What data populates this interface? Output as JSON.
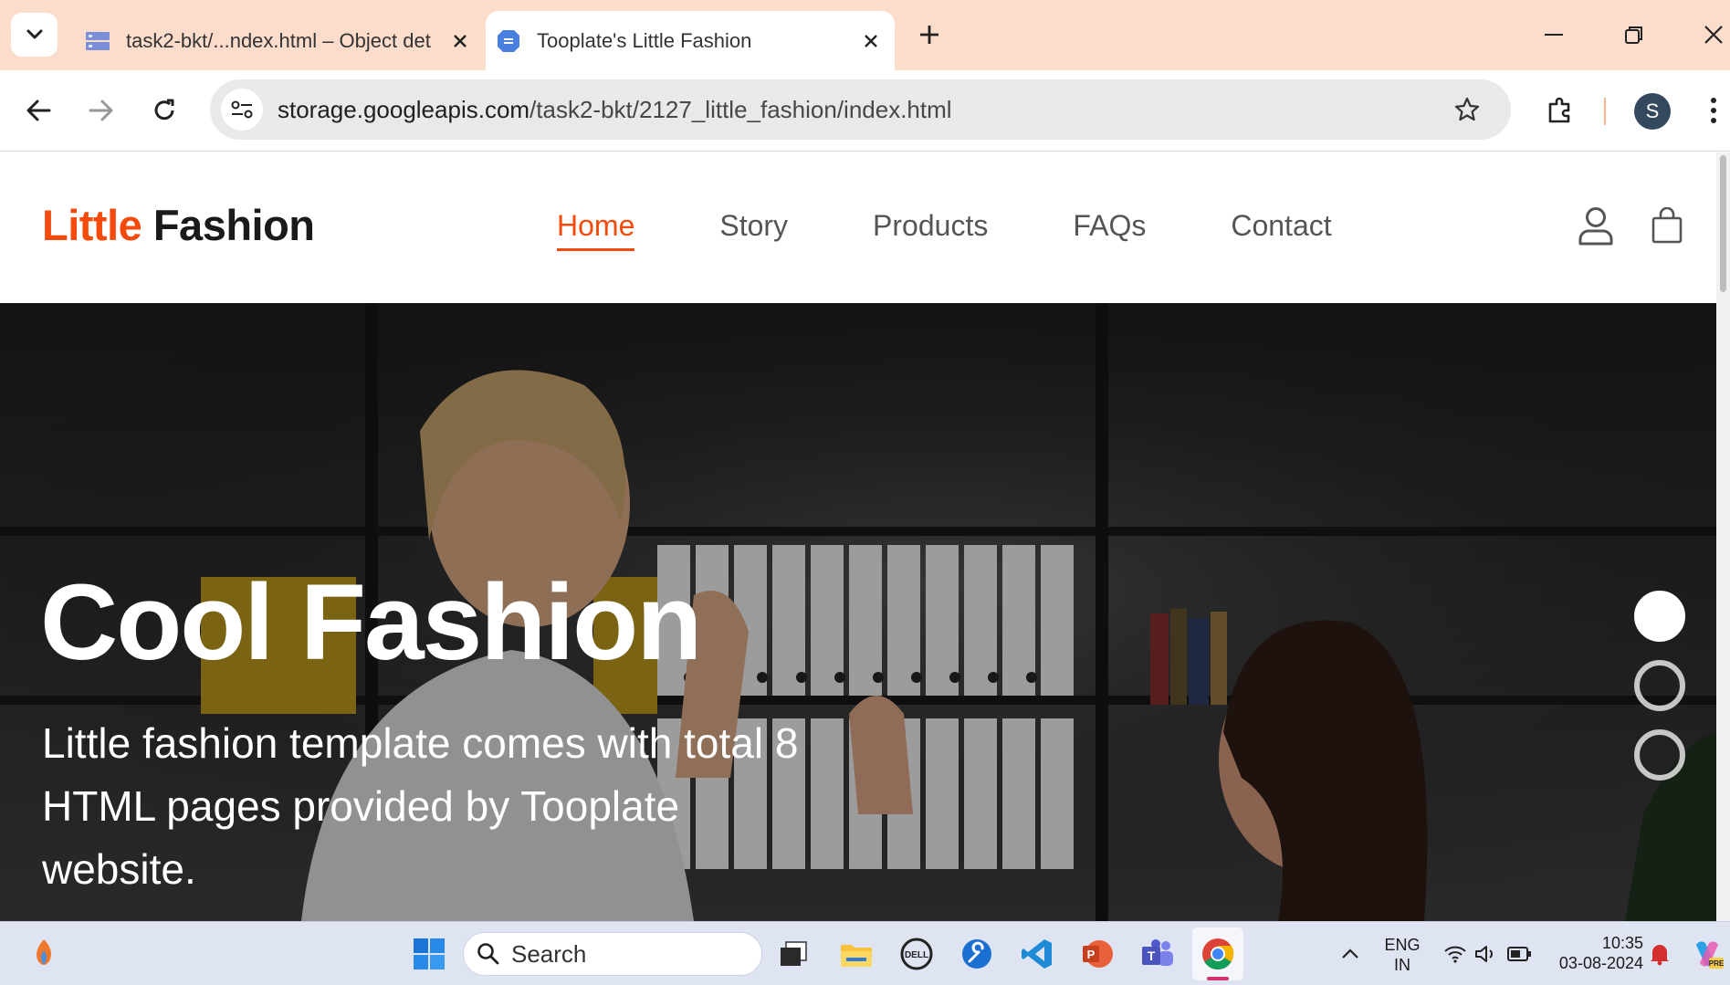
{
  "browser": {
    "tabs": [
      {
        "title": "task2-bkt/...ndex.html – Object det",
        "active": false
      },
      {
        "title": "Tooplate's Little Fashion",
        "active": true
      }
    ],
    "url_host": "storage.googleapis.com",
    "url_path": "/task2-bkt/2127_little_fashion/index.html",
    "profile_initial": "S"
  },
  "site": {
    "brand_accent": "Little",
    "brand_main": "Fashion",
    "menu": [
      "Home",
      "Story",
      "Products",
      "FAQs",
      "Contact"
    ],
    "active_menu": "Home",
    "accent_color": "#f44b0c"
  },
  "hero": {
    "title": "Cool Fashion",
    "text": "Little fashion template comes with total 8 HTML pages provided by Tooplate website.",
    "slides": 3,
    "active_slide": 1
  },
  "taskbar": {
    "search_label": "Search",
    "lang_top": "ENG",
    "lang_bottom": "IN",
    "time": "10:35",
    "date": "03-08-2024"
  }
}
